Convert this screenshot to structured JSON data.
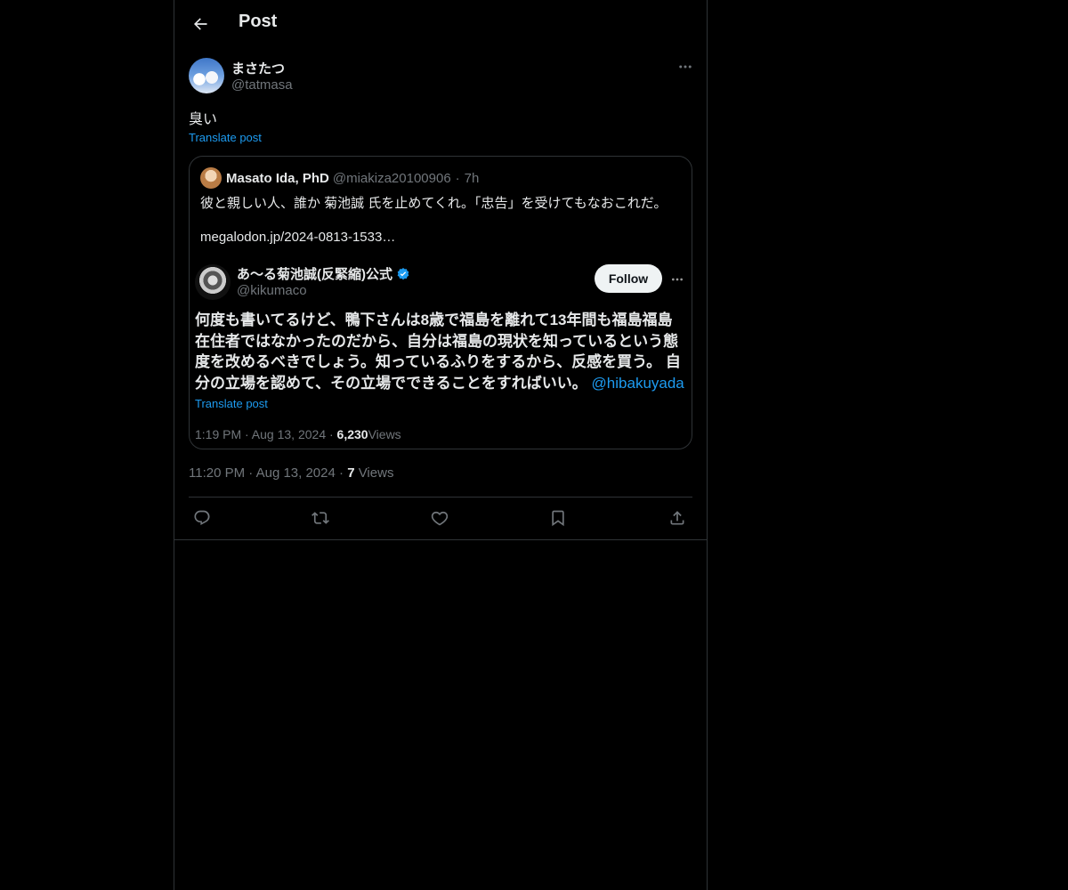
{
  "header": {
    "title": "Post",
    "back_icon": "arrow-left-icon"
  },
  "post": {
    "author_name": "まさたつ",
    "author_handle": "@tatmasa",
    "text": "臭い",
    "translate_label": "Translate post",
    "timestamp": "11:20 PM · Aug 13, 2024",
    "views_count": "7",
    "views_label": "Views",
    "more_icon": "ellipsis-icon"
  },
  "quote": {
    "author_name": "Masato Ida, PhD",
    "author_handle": "@miakiza20100906",
    "age": "7h",
    "text": "彼と親しい人、誰か 菊池誠 氏を止めてくれ。「忠告」を受けてもなおこれだ。",
    "link": "megalodon.jp/2024-0813-1533…",
    "embedded": {
      "author_name": "あ〜る菊池誠(反緊縮)公式",
      "author_handle": "@kikumaco",
      "verified": true,
      "follow_label": "Follow",
      "text": "何度も書いてるけど、鴨下さんは8歳で福島を離れて13年間も福島福島在住者ではなかったのだから、自分は福島の現状を知っているという態度を改めるべきでしょう。知っているふりをするから、反感を買う。 自分の立場を認めて、その立場でできることをすればいい。",
      "mention": "@hibakuyada",
      "translate_label": "Translate post",
      "time": "1:19 PM · Aug 13, 2024 · ",
      "views_count": "6,230",
      "views_label": "Views"
    }
  },
  "actions": {
    "reply_icon": "reply-icon",
    "repost_icon": "repost-icon",
    "like_icon": "heart-icon",
    "bookmark_icon": "bookmark-icon",
    "share_icon": "share-icon"
  },
  "colors": {
    "accent": "#1d9bf0",
    "text": "#e7e9ea",
    "muted": "#71767b",
    "border": "#2f3336",
    "background": "#000000"
  }
}
